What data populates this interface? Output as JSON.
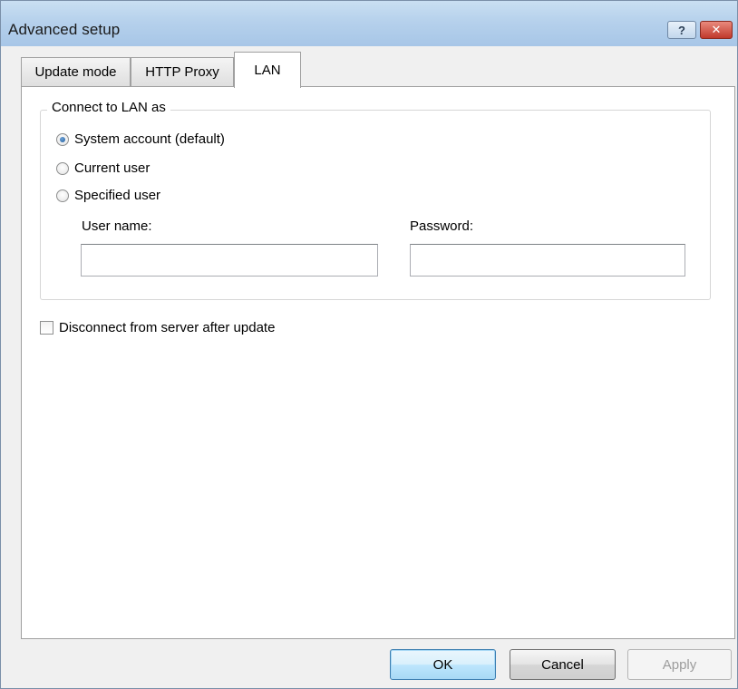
{
  "window": {
    "title": "Advanced setup",
    "help_glyph": "?",
    "close_glyph": "✕"
  },
  "tabs": [
    {
      "label": "Update mode",
      "active": false
    },
    {
      "label": "HTTP Proxy",
      "active": false
    },
    {
      "label": "LAN",
      "active": true
    }
  ],
  "lan": {
    "group_label": "Connect to LAN as",
    "options": [
      {
        "label": "System account (default)",
        "checked": true
      },
      {
        "label": "Current user",
        "checked": false
      },
      {
        "label": "Specified user",
        "checked": false
      }
    ],
    "username_label": "User name:",
    "username_value": "",
    "password_label": "Password:",
    "password_value": "",
    "disconnect_label": "Disconnect from server after update",
    "disconnect_checked": false
  },
  "buttons": {
    "ok": "OK",
    "cancel": "Cancel",
    "apply": "Apply"
  },
  "colors": {
    "titlebar": "#b6d1ec",
    "close": "#c0392b",
    "radio_dot": "#1f5a9a"
  }
}
